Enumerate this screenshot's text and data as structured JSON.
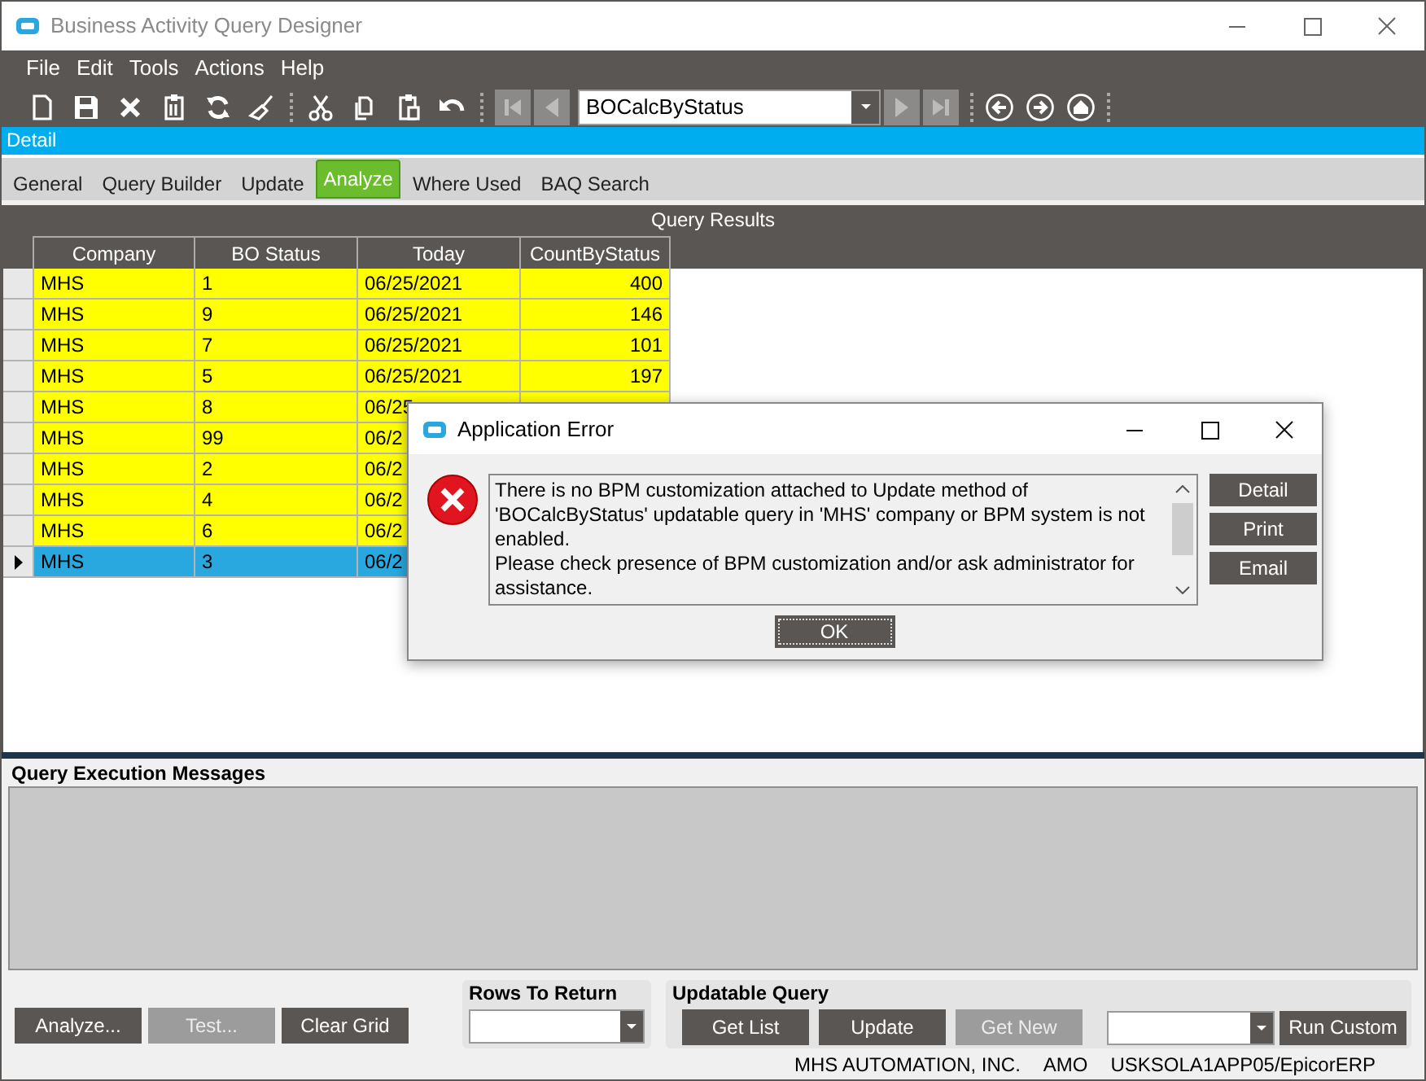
{
  "window": {
    "title": "Business Activity Query Designer"
  },
  "menu": [
    "File",
    "Edit",
    "Tools",
    "Actions",
    "Help"
  ],
  "toolbar": {
    "record": "BOCalcByStatus"
  },
  "panel_title": "Detail",
  "tabs": [
    {
      "label": "General",
      "selected": false
    },
    {
      "label": "Query Builder",
      "selected": false
    },
    {
      "label": "Update",
      "selected": false
    },
    {
      "label": "Analyze",
      "selected": true
    },
    {
      "label": "Where Used",
      "selected": false
    },
    {
      "label": "BAQ Search",
      "selected": false
    }
  ],
  "query_results": {
    "title": "Query Results",
    "columns": [
      "Company",
      "BO Status",
      "Today",
      "CountByStatus"
    ],
    "rows": [
      {
        "cells": [
          "MHS",
          "1",
          "06/25/2021",
          "400"
        ],
        "selected": false
      },
      {
        "cells": [
          "MHS",
          "9",
          "06/25/2021",
          "146"
        ],
        "selected": false
      },
      {
        "cells": [
          "MHS",
          "7",
          "06/25/2021",
          "101"
        ],
        "selected": false
      },
      {
        "cells": [
          "MHS",
          "5",
          "06/25/2021",
          "197"
        ],
        "selected": false
      },
      {
        "cells": [
          "MHS",
          "8",
          "06/25"
        ],
        "selected": false
      },
      {
        "cells": [
          "MHS",
          "99",
          "06/2"
        ],
        "selected": false
      },
      {
        "cells": [
          "MHS",
          "2",
          "06/2"
        ],
        "selected": false
      },
      {
        "cells": [
          "MHS",
          "4",
          "06/2"
        ],
        "selected": false
      },
      {
        "cells": [
          "MHS",
          "6",
          "06/2"
        ],
        "selected": false
      },
      {
        "cells": [
          "MHS",
          "3",
          "06/2"
        ],
        "selected": true
      }
    ]
  },
  "messages": {
    "title": "Query Execution Messages"
  },
  "actions": [
    {
      "label": "Analyze...",
      "disabled": false
    },
    {
      "label": "Test...",
      "disabled": true
    },
    {
      "label": "Clear Grid",
      "disabled": false
    }
  ],
  "rows_to_return": {
    "label": "Rows To Return"
  },
  "updatable_query": {
    "label": "Updatable Query",
    "buttons": [
      {
        "label": "Get List",
        "disabled": false
      },
      {
        "label": "Update",
        "disabled": false
      },
      {
        "label": "Get New",
        "disabled": true
      }
    ]
  },
  "run_custom": {
    "label": "Run Custom"
  },
  "status_bar": [
    "MHS AUTOMATION, INC.",
    "AMO",
    "USKSOLA1APP05/EpicorERP"
  ],
  "dialog": {
    "title": "Application Error",
    "message": [
      "There is no BPM customization attached to Update method of 'BOCalcByStatus' updatable query in 'MHS' company or BPM system is not enabled.",
      "Please check presence of BPM customization and/or ask administrator for assistance."
    ],
    "side_buttons": [
      "Detail",
      "Print",
      "Email"
    ],
    "ok": "OK"
  }
}
